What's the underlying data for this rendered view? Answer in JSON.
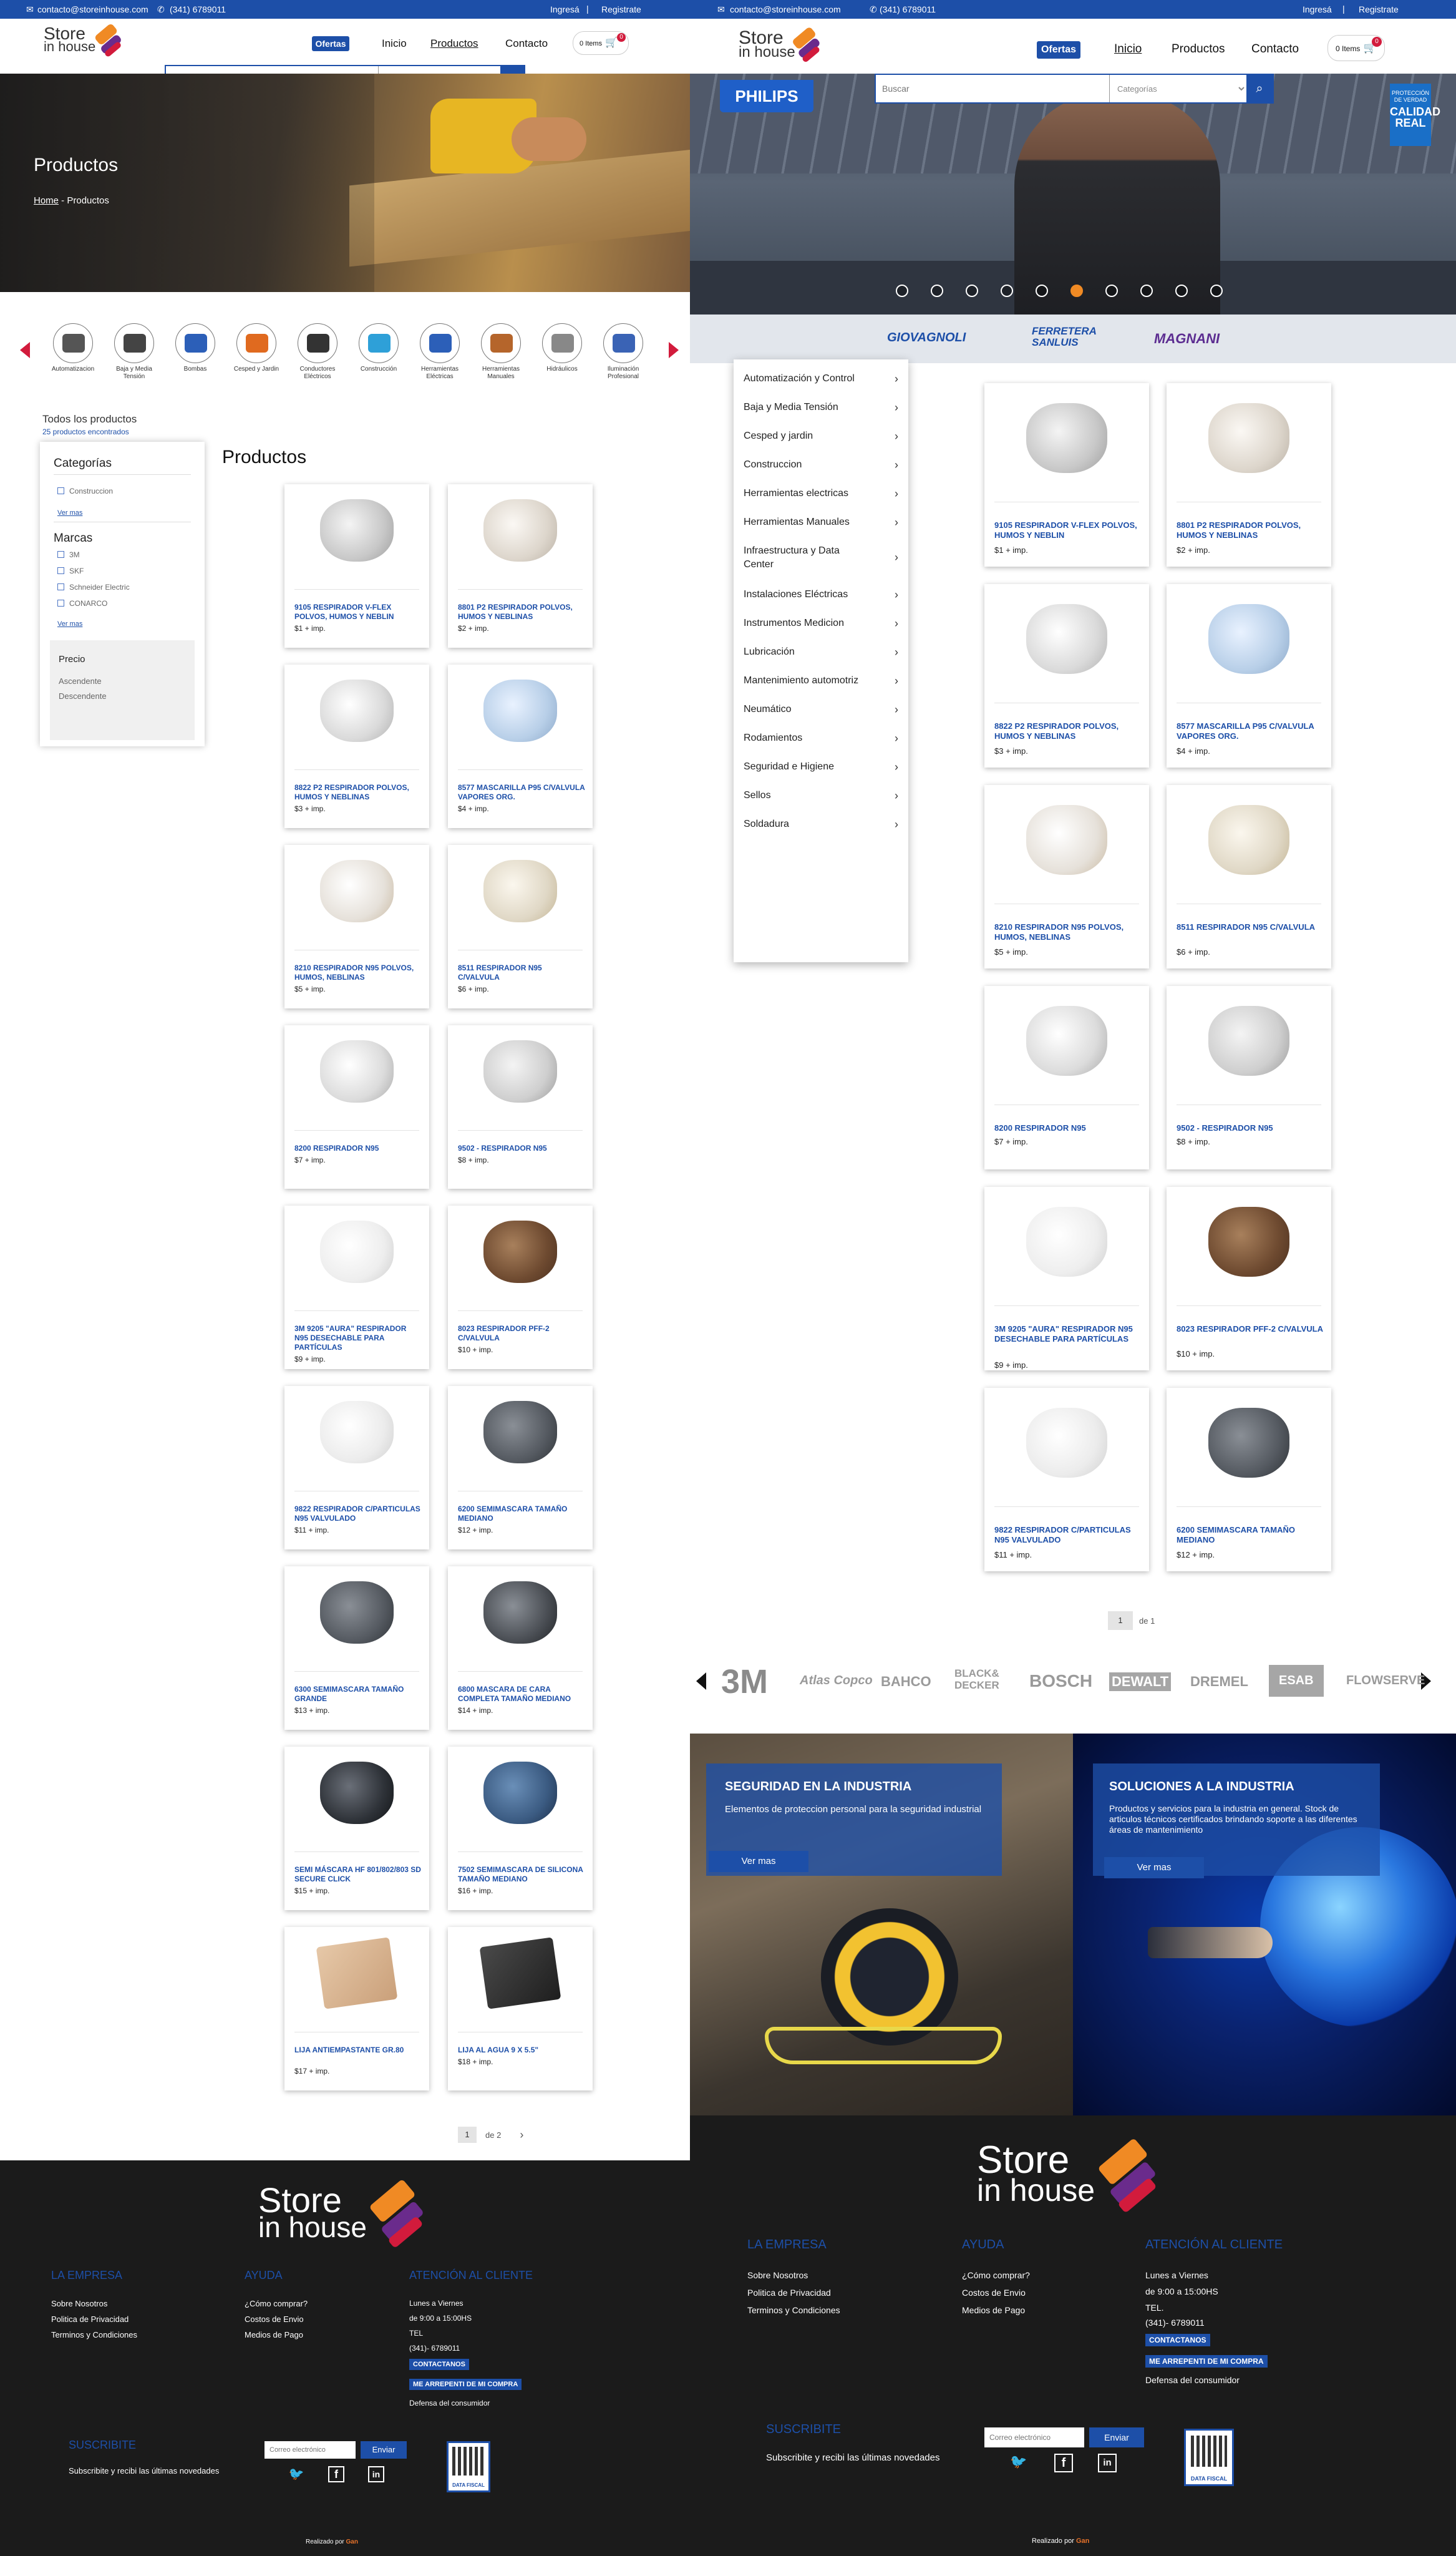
{
  "topbar": {
    "email": "contacto@storeinhouse.com",
    "phone": "(341) 6789011",
    "login": "Ingresá",
    "divider": "|",
    "register": "Registrate"
  },
  "brand": {
    "line1": "Store",
    "line2": "in house"
  },
  "nav": {
    "ofertas": "Ofertas",
    "inicio": "Inicio",
    "productos": "Productos",
    "contacto": "Contacto"
  },
  "cart": {
    "label": "0 Items",
    "count": "0"
  },
  "search": {
    "placeholder": "Buscar",
    "category_placeholder": "Categorías"
  },
  "page_hero": {
    "title": "Productos",
    "crumb_home": "Home",
    "crumb_sep": " - ",
    "crumb_current": "Productos"
  },
  "category_strip": [
    {
      "label": "Automatizacion"
    },
    {
      "label": "Baja y Media Tensión"
    },
    {
      "label": "Bombas"
    },
    {
      "label": "Cesped y Jardin"
    },
    {
      "label": "Conductores Eléctricos"
    },
    {
      "label": "Construcción"
    },
    {
      "label": "Herramientas Eléctricas"
    },
    {
      "label": "Herramientas Manuales"
    },
    {
      "label": "Hidráulicos"
    },
    {
      "label": "Iluminación Profesional"
    }
  ],
  "results": {
    "title": "Todos los productos",
    "count": "25 productos encontrados"
  },
  "filters": {
    "categorias_title": "Categorías",
    "categorias": [
      "Construccion"
    ],
    "ver_mas": "Ver mas",
    "marcas_title": "Marcas",
    "marcas": [
      "3M",
      "SKF",
      "Schneider Electric",
      "CONARCO"
    ],
    "precio_title": "Precio",
    "precio_opts": [
      "Ascendente",
      "Descendente"
    ]
  },
  "grid_title": "Productos",
  "products": [
    {
      "name": "9105 RESPIRADOR V-FLEX POLVOS, HUMOS Y NEBLIN",
      "price": "$1 + imp."
    },
    {
      "name": "8801 P2 RESPIRADOR POLVOS, HUMOS Y NEBLINAS",
      "price": "$2 + imp."
    },
    {
      "name": "8822 P2 RESPIRADOR POLVOS, HUMOS Y NEBLINAS",
      "price": "$3 + imp."
    },
    {
      "name": "8577 MASCARILLA P95 C/VALVULA VAPORES ORG.",
      "price": "$4 + imp."
    },
    {
      "name": "8210 RESPIRADOR N95 POLVOS, HUMOS, NEBLINAS",
      "price": "$5 + imp."
    },
    {
      "name": "8511 RESPIRADOR N95 C/VALVULA",
      "price": "$6 + imp."
    },
    {
      "name": "8200 RESPIRADOR N95",
      "price": "$7 + imp."
    },
    {
      "name": "9502 - RESPIRADOR N95",
      "price": "$8 + imp."
    },
    {
      "name": "3M 9205 \"AURA\" RESPIRADOR N95 DESECHABLE PARA PARTÍCULAS",
      "price": "$9 + imp."
    },
    {
      "name": "8023 RESPIRADOR PFF-2 C/VALVULA",
      "price": "$10 + imp."
    },
    {
      "name": "9822 RESPIRADOR C/PARTICULAS N95 VALVULADO",
      "price": "$11 + imp."
    },
    {
      "name": "6200 SEMIMASCARA TAMAÑO MEDIANO",
      "price": "$12 + imp."
    },
    {
      "name": "6300 SEMIMASCARA TAMAÑO GRANDE",
      "price": "$13 + imp."
    },
    {
      "name": "6800 MASCARA DE CARA COMPLETA TAMAÑO MEDIANO",
      "price": "$14 + imp."
    },
    {
      "name": "SEMI MÁSCARA HF 801/802/803 SD SECURE CLICK",
      "price": "$15 + imp."
    },
    {
      "name": "7502 SEMIMASCARA DE SILICONA TAMAÑO MEDIANO",
      "price": "$16 + imp."
    },
    {
      "name": "LIJA ANTIEMPASTANTE GR.80",
      "price": "$17 + imp."
    },
    {
      "name": "LIJA AL AGUA 9 x 5.5\"",
      "price": "$18 + imp."
    }
  ],
  "pager_left": {
    "page": "1",
    "of": "de 2",
    "next": "›"
  },
  "pager_right": {
    "page": "1",
    "of": "de 1"
  },
  "hero_right": {
    "brand": "PHILIPS",
    "badge_top": "PROTECCIÓN DE VERDAD",
    "badge_main": "CALIDAD REAL"
  },
  "brand_band": [
    "GIOVAGNOLI",
    "FERRETERA SANLUIS",
    "MAGNANI"
  ],
  "menu": [
    "Automatización y Control",
    "Baja y Media Tensión",
    "Cesped y jardin",
    "Construccion",
    "Herramientas electricas",
    "Herramientas Manuales",
    "Infraestructura y Data Center",
    "Instalaciones Eléctricas",
    "Instrumentos Medicion",
    "Lubricación",
    "Mantenimiento automotriz",
    "Neumático",
    "Rodamientos",
    "Seguridad e Higiene",
    "Sellos",
    "Soldadura"
  ],
  "brand_strip": [
    "3M",
    "Atlas Copco",
    "BAHCO",
    "BLACK& DECKER",
    "BOSCH",
    "DEWALT",
    "DREMEL",
    "ESAB",
    "FLOWSERVE"
  ],
  "banners": [
    {
      "title": "SEGURIDAD EN LA INDUSTRIA",
      "desc": "Elementos de proteccion personal para la seguridad industrial",
      "button": "Ver mas"
    },
    {
      "title": "SOLUCIONES A LA INDUSTRIA",
      "desc": "Productos y servicios para la industria en general. Stock de articulos técnicos certificados brindando soporte a las diferentes áreas de mantenimiento",
      "button": "Ver mas"
    }
  ],
  "footer": {
    "empresa_title": "LA EMPRESA",
    "empresa_links": [
      "Sobre Nosotros",
      "Politica de Privacidad",
      "Terminos y Condiciones"
    ],
    "ayuda_title": "AYUDA",
    "ayuda_links": [
      "¿Cómo comprar?",
      "Costos de Envio",
      "Medios de Pago"
    ],
    "atencion_title": "ATENCIÓN AL CLIENTE",
    "horario1": "Lunes a Viernes",
    "horario2": "de 9:00 a 15:00HS",
    "tel_label": "TEL",
    "tel_label_right": "TEL.",
    "tel": "(341)- 6789011",
    "contact_button": "CONTACTANOS",
    "arrepenti_button": "ME ARREPENTI DE MI COMPRA",
    "defensa": "Defensa del consumidor",
    "suscribite": "SUSCRIBITE",
    "suscribite_text": "Subscribite y recibi las últimas novedades",
    "email_placeholder": "Correo electrónico",
    "enviar": "Enviar",
    "qr_label": "DATA FISCAL",
    "credit_prefix": "Realizado por",
    "credit_brand": "Gan"
  }
}
